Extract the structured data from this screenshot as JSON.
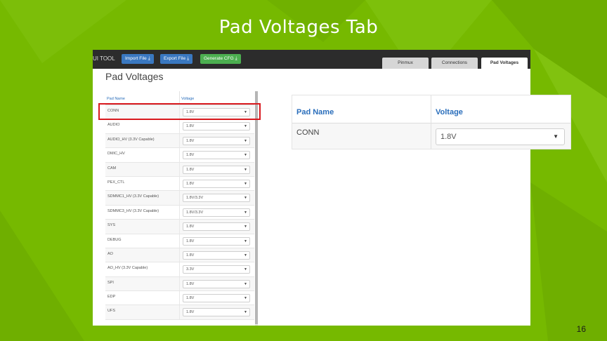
{
  "slide": {
    "title": "Pad Voltages Tab",
    "page_number": "16",
    "background_color": "#76b900"
  },
  "app": {
    "title": "UI TOOL",
    "buttons": {
      "import_label": "Import File",
      "export_label": "Export File",
      "generate_label": "Generate CFG"
    },
    "tabs": [
      {
        "label": "Pinmux",
        "active": false
      },
      {
        "label": "Connections",
        "active": false
      },
      {
        "label": "Pad Voltages",
        "active": true
      }
    ],
    "section_title": "Pad Voltages",
    "table": {
      "headers": {
        "pad_name": "Pad Name",
        "voltage": "Voltage"
      },
      "rows": [
        {
          "pad": "CONN",
          "voltage": "1.8V"
        },
        {
          "pad": "AUDIO",
          "voltage": "1.8V"
        },
        {
          "pad": "AUDIO_HV (3.3V Capable)",
          "voltage": "1.8V"
        },
        {
          "pad": "DMIC_HV",
          "voltage": "1.8V"
        },
        {
          "pad": "CAM",
          "voltage": "1.8V"
        },
        {
          "pad": "PEX_CTL",
          "voltage": "1.8V"
        },
        {
          "pad": "SDMMC1_HV (3.3V Capable)",
          "voltage": "1.8V/3.3V"
        },
        {
          "pad": "SDMMC3_HV (3.3V Capable)",
          "voltage": "1.8V/3.3V"
        },
        {
          "pad": "SYS",
          "voltage": "1.8V"
        },
        {
          "pad": "DEBUG",
          "voltage": "1.8V"
        },
        {
          "pad": "AO",
          "voltage": "1.8V"
        },
        {
          "pad": "AO_HV (3.3V Capable)",
          "voltage": "3.3V"
        },
        {
          "pad": "SPI",
          "voltage": "1.8V"
        },
        {
          "pad": "EDP",
          "voltage": "1.8V"
        },
        {
          "pad": "UFS",
          "voltage": "1.8V"
        }
      ]
    }
  },
  "zoom": {
    "header_pad_name": "Pad Name",
    "header_voltage": "Voltage",
    "pad": "CONN",
    "voltage": "1.8V"
  },
  "icons": {
    "download": "download-icon",
    "dropdown": "chevron-down-icon"
  },
  "colors": {
    "highlight": "#d9191e",
    "header_text": "#2a6ebb"
  }
}
